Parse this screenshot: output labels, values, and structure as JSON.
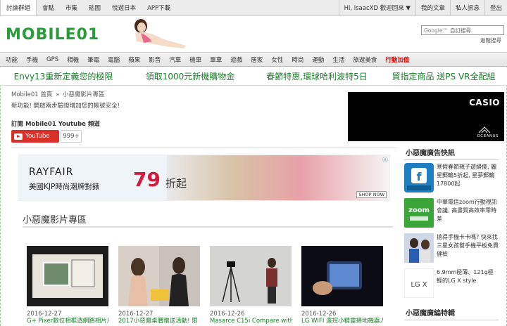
{
  "topbar": {
    "left": [
      "討論群組",
      "會點",
      "市集",
      "貼圖",
      "悅遊日本",
      "APP下載"
    ],
    "right": [
      "Hi, isaacXD 歡迎回來 ▼",
      "我的文章",
      "私人訊息",
      "登出"
    ]
  },
  "header": {
    "logo": "MOBILE01",
    "search_placeholder": "自訂搜尋",
    "search_brand": "Google™",
    "advanced_link": "進階搜尋"
  },
  "catnav": [
    "功能",
    "手機",
    "GPS",
    "相機",
    "筆電",
    "電腦",
    "蘋果",
    "影音",
    "汽車",
    "機車",
    "單車",
    "遊戲",
    "居家",
    "女性",
    "時尚",
    "運動",
    "生活",
    "旅遊美食",
    "行動加值"
  ],
  "promos": [
    "Envy13重新定義您的極限",
    "領取1000元新機購物金",
    "春節特惠,環球哈利波特5日",
    "貿指定商品 送PS VR全配組"
  ],
  "main": {
    "breadcrumb": [
      "Mobile01 首頁",
      "»",
      "小惡魔影片專區"
    ],
    "notice": "新功能! 開啟兩步驗證增加您的帳號安全!",
    "subscribe": "訂閱 Mobile01 Youtube 頻道",
    "youtube_label": "YouTube",
    "youtube_count": "999+",
    "casio_brand": "CASIO",
    "casio_sub": "OCEANUS",
    "banner": {
      "brand": "RAYFAIR",
      "slogan": "美國KJP時尚潮牌對錶",
      "number": "79",
      "zhe": "折起",
      "shop": "SHOP NOW",
      "close": "ⓧ"
    },
    "section_title": "小惡魔影片專區",
    "videos": [
      {
        "date": "2016-12-27",
        "title": "G+ Pixer數位相框透網路相片片"
      },
      {
        "date": "2016-12-27",
        "title": "2017小惡魔桌曆贈送活動! 限"
      },
      {
        "date": "2016-12-26",
        "title": "Masarce C15i Compare with"
      },
      {
        "date": "2016-12-26",
        "title": "LG WIFI 遠控小精靈掃地機器人"
      }
    ]
  },
  "sidebar": {
    "ads_title": "小惡魔廣告快訊",
    "ads": [
      {
        "icon": "travel-app-icon",
        "text": "寒假春節親子遊婦傻, 麗星郵輪5折起, 星夢郵輪17800起"
      },
      {
        "icon": "zoom-icon",
        "text": "中華電信zoom行動視訊會議, 高畫質高效率零時差"
      },
      {
        "icon": "people-icon",
        "text": "搶得手機卡卡嗎? 快來找三星女孩幫手機平板免費健檢"
      },
      {
        "icon": "lg-xstyle-icon",
        "text": "6.9mm極薄、121g極輕的LG X style"
      }
    ],
    "news_title": "小惡魔廣編特輯"
  }
}
